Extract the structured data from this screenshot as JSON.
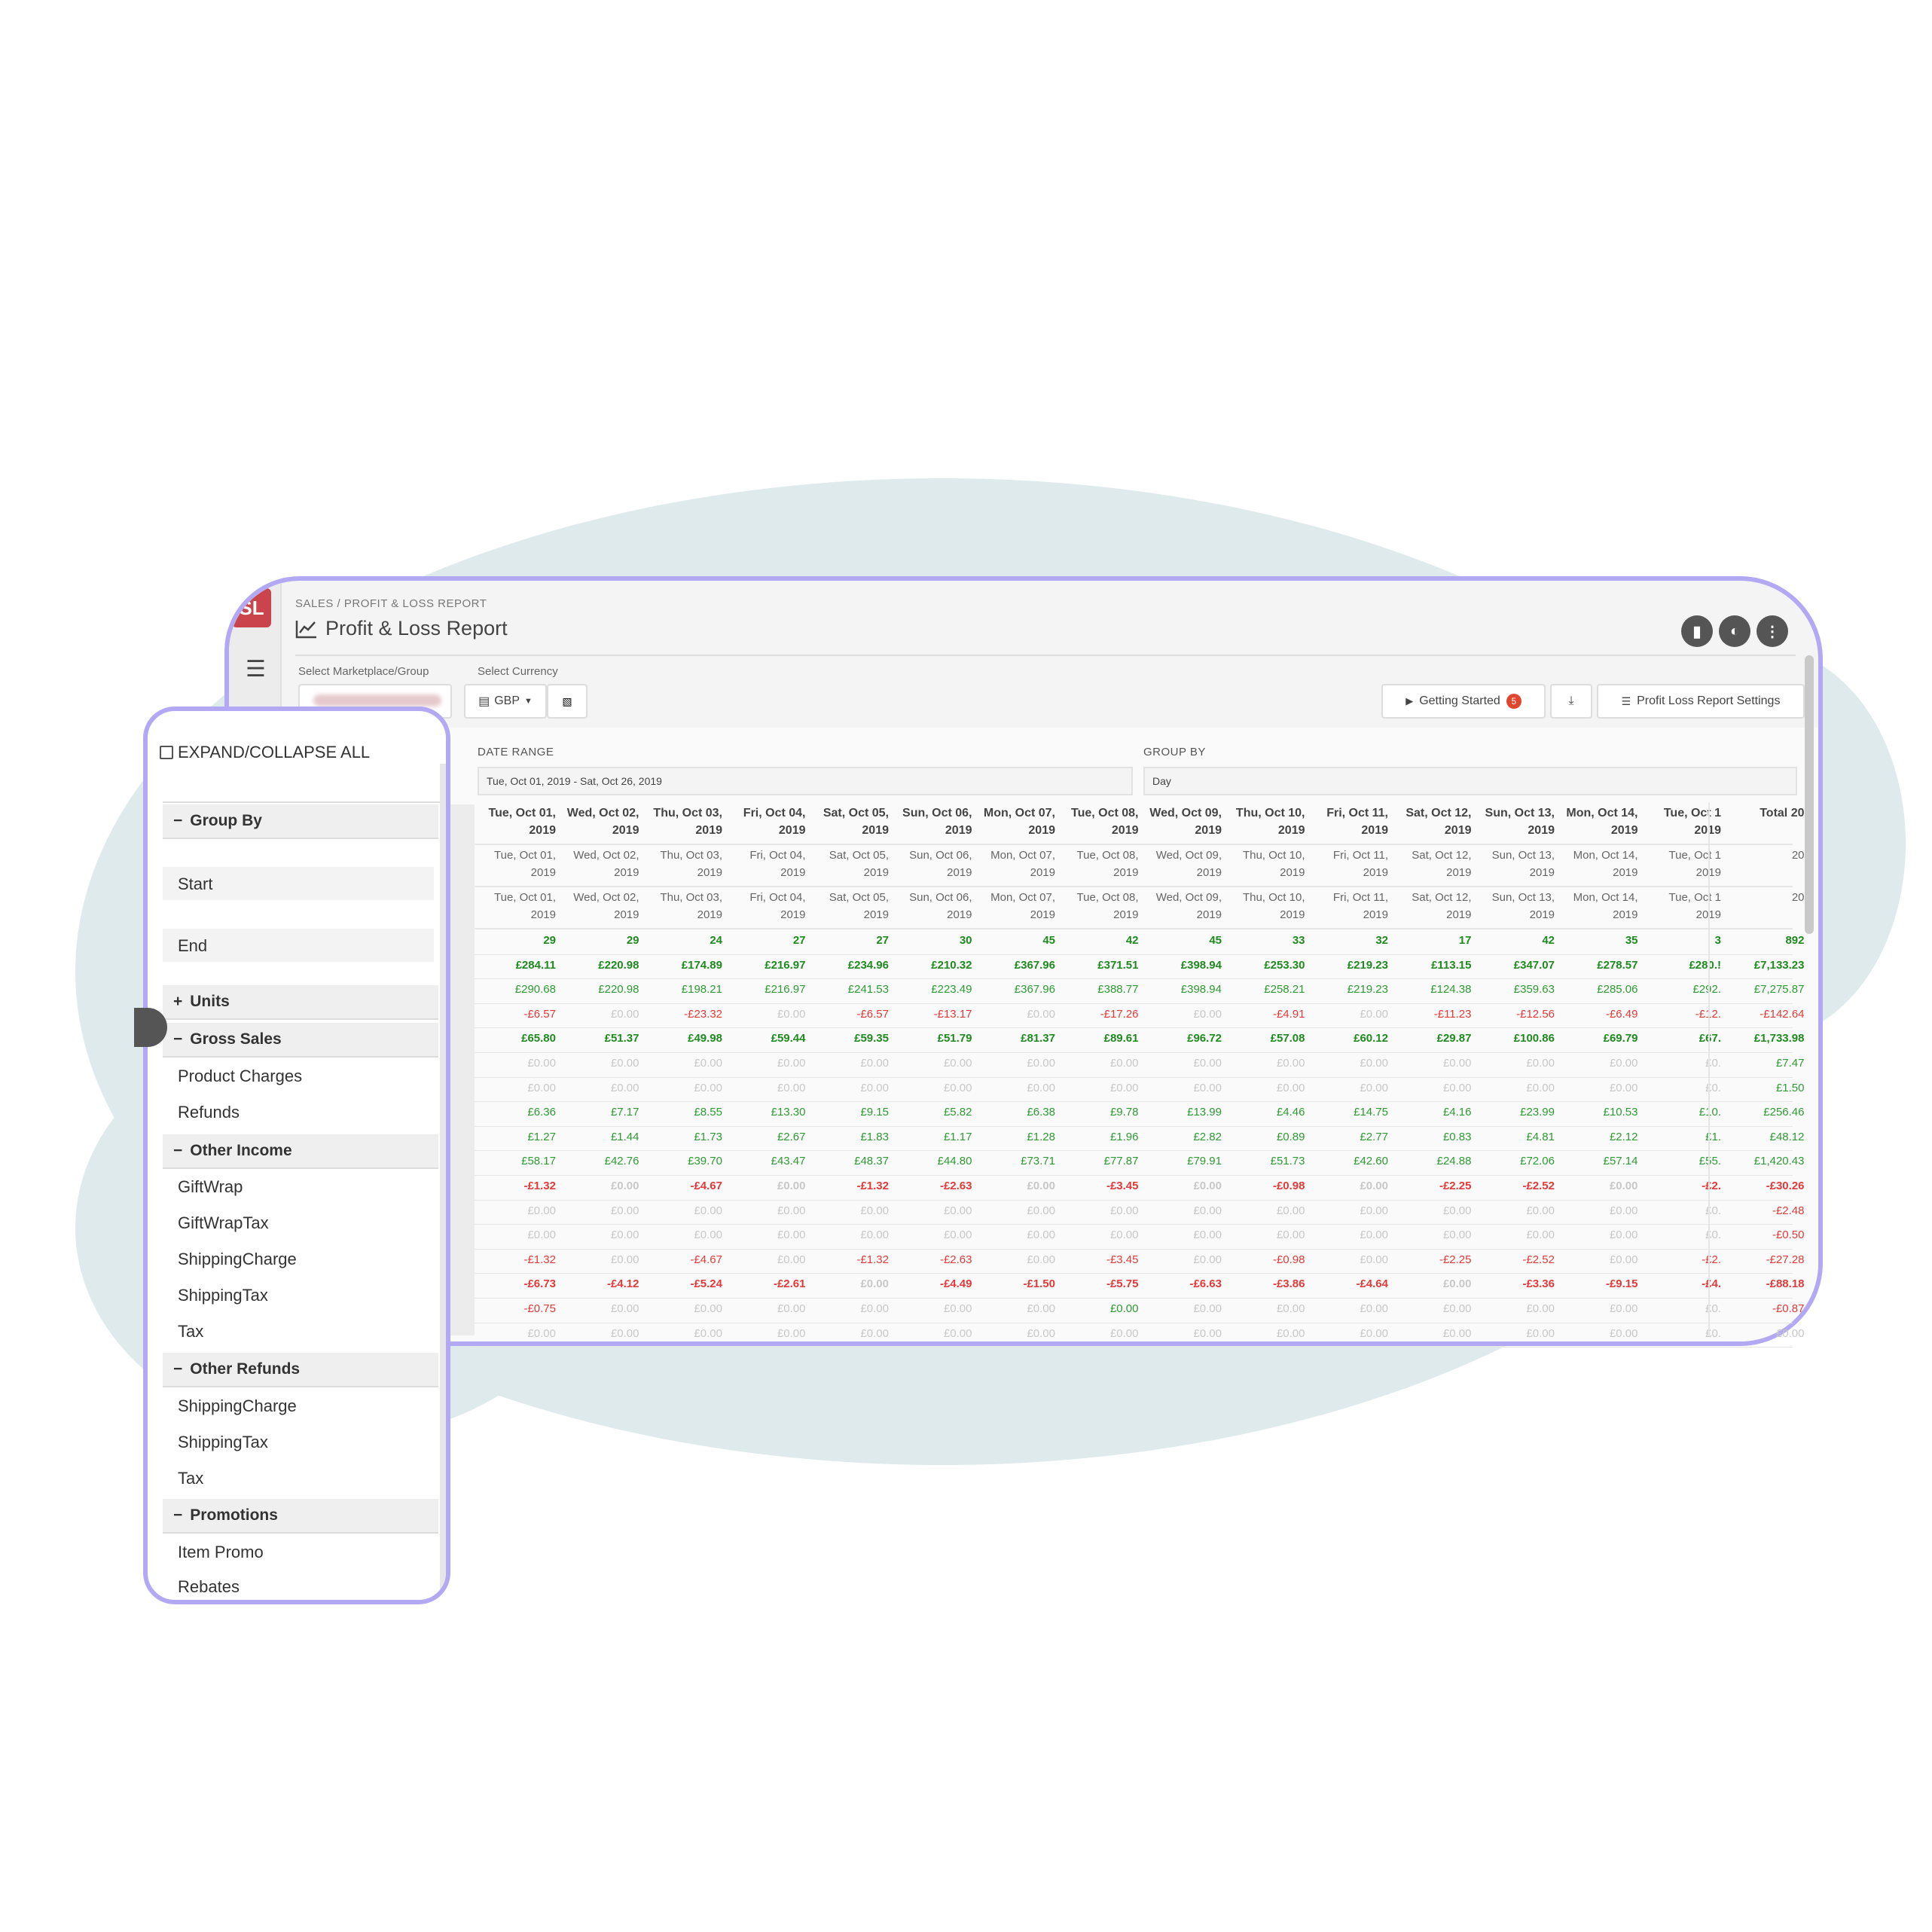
{
  "app": {
    "logo_text": "SL",
    "breadcrumb": "SALES / PROFIT & LOSS REPORT",
    "title": "Profit & Loss Report"
  },
  "filters": {
    "marketplace_label": "Select Marketplace/Group",
    "currency_label": "Select Currency",
    "currency_value": "GBP",
    "getting_started": "Getting Started",
    "getting_started_badge": "5",
    "settings_button": "Profit Loss Report Settings",
    "date_range_label": "DATE RANGE",
    "date_range_value": "Tue, Oct 01, 2019 - Sat, Oct 26, 2019",
    "group_by_label": "GROUP BY",
    "group_by_value": "Day"
  },
  "table": {
    "headers": [
      "Tue, Oct 01, 2019",
      "Wed, Oct 02, 2019",
      "Thu, Oct 03, 2019",
      "Fri, Oct 04, 2019",
      "Sat, Oct 05, 2019",
      "Sun, Oct 06, 2019",
      "Mon, Oct 07, 2019",
      "Tue, Oct 08, 2019",
      "Wed, Oct 09, 2019",
      "Thu, Oct 10, 2019",
      "Fri, Oct 11, 2019",
      "Sat, Oct 12, 2019",
      "Sun, Oct 13, 2019",
      "Mon, Oct 14, 2019",
      "Tue, Oct 1 2019",
      "Total 20"
    ],
    "start_dates": [
      "Tue, Oct 01, 2019",
      "Wed, Oct 02, 2019",
      "Thu, Oct 03, 2019",
      "Fri, Oct 04, 2019",
      "Sat, Oct 05, 2019",
      "Sun, Oct 06, 2019",
      "Mon, Oct 07, 2019",
      "Tue, Oct 08, 2019",
      "Wed, Oct 09, 2019",
      "Thu, Oct 10, 2019",
      "Fri, Oct 11, 2019",
      "Sat, Oct 12, 2019",
      "Sun, Oct 13, 2019",
      "Mon, Oct 14, 2019",
      "Tue, Oct 1 2019",
      "20"
    ],
    "end_dates": [
      "Tue, Oct 01, 2019",
      "Wed, Oct 02, 2019",
      "Thu, Oct 03, 2019",
      "Fri, Oct 04, 2019",
      "Sat, Oct 05, 2019",
      "Sun, Oct 06, 2019",
      "Mon, Oct 07, 2019",
      "Tue, Oct 08, 2019",
      "Wed, Oct 09, 2019",
      "Thu, Oct 10, 2019",
      "Fri, Oct 11, 2019",
      "Sat, Oct 12, 2019",
      "Sun, Oct 13, 2019",
      "Mon, Oct 14, 2019",
      "Tue, Oct 1 2019",
      "20"
    ],
    "rows": [
      {
        "style": "bold",
        "cells": [
          "29",
          "29",
          "24",
          "27",
          "27",
          "30",
          "45",
          "42",
          "45",
          "33",
          "32",
          "17",
          "42",
          "35",
          "3",
          "892"
        ],
        "colors": [
          "gb"
        ]
      },
      {
        "style": "bold",
        "cells": [
          "£284.11",
          "£220.98",
          "£174.89",
          "£216.97",
          "£234.96",
          "£210.32",
          "£367.96",
          "£371.51",
          "£398.94",
          "£253.30",
          "£219.23",
          "£113.15",
          "£347.07",
          "£278.57",
          "£280.!",
          "£7,133.23"
        ],
        "colors": [
          "gb"
        ]
      },
      {
        "style": "normal",
        "cells": [
          "£290.68",
          "£220.98",
          "£198.21",
          "£216.97",
          "£241.53",
          "£223.49",
          "£367.96",
          "£388.77",
          "£398.94",
          "£258.21",
          "£219.23",
          "£124.38",
          "£359.63",
          "£285.06",
          "£292.",
          "£7,275.87"
        ],
        "colors": [
          "g"
        ]
      },
      {
        "style": "normal",
        "cells": [
          "-£6.57",
          "£0.00",
          "-£23.32",
          "£0.00",
          "-£6.57",
          "-£13.17",
          "£0.00",
          "-£17.26",
          "£0.00",
          "-£4.91",
          "£0.00",
          "-£11.23",
          "-£12.56",
          "-£6.49",
          "-£12.",
          "-£142.64"
        ],
        "colors": [
          "r",
          "gr",
          "r",
          "gr",
          "r",
          "r",
          "gr",
          "r",
          "gr",
          "r",
          "gr",
          "r",
          "r",
          "r",
          "r",
          "r"
        ]
      },
      {
        "style": "bold",
        "cells": [
          "£65.80",
          "£51.37",
          "£49.98",
          "£59.44",
          "£59.35",
          "£51.79",
          "£81.37",
          "£89.61",
          "£96.72",
          "£57.08",
          "£60.12",
          "£29.87",
          "£100.86",
          "£69.79",
          "£67.",
          "£1,733.98"
        ],
        "colors": [
          "gb"
        ]
      },
      {
        "style": "normal",
        "cells": [
          "£0.00",
          "£0.00",
          "£0.00",
          "£0.00",
          "£0.00",
          "£0.00",
          "£0.00",
          "£0.00",
          "£0.00",
          "£0.00",
          "£0.00",
          "£0.00",
          "£0.00",
          "£0.00",
          "£0.",
          "£7.47"
        ],
        "colors": [
          "gr",
          "gr",
          "gr",
          "gr",
          "gr",
          "gr",
          "gr",
          "gr",
          "gr",
          "gr",
          "gr",
          "gr",
          "gr",
          "gr",
          "gr",
          "g"
        ]
      },
      {
        "style": "normal",
        "cells": [
          "£0.00",
          "£0.00",
          "£0.00",
          "£0.00",
          "£0.00",
          "£0.00",
          "£0.00",
          "£0.00",
          "£0.00",
          "£0.00",
          "£0.00",
          "£0.00",
          "£0.00",
          "£0.00",
          "£0.",
          "£1.50"
        ],
        "colors": [
          "gr",
          "gr",
          "gr",
          "gr",
          "gr",
          "gr",
          "gr",
          "gr",
          "gr",
          "gr",
          "gr",
          "gr",
          "gr",
          "gr",
          "gr",
          "g"
        ]
      },
      {
        "style": "normal",
        "cells": [
          "£6.36",
          "£7.17",
          "£8.55",
          "£13.30",
          "£9.15",
          "£5.82",
          "£6.38",
          "£9.78",
          "£13.99",
          "£4.46",
          "£14.75",
          "£4.16",
          "£23.99",
          "£10.53",
          "£10.",
          "£256.46"
        ],
        "colors": [
          "g"
        ]
      },
      {
        "style": "normal",
        "cells": [
          "£1.27",
          "£1.44",
          "£1.73",
          "£2.67",
          "£1.83",
          "£1.17",
          "£1.28",
          "£1.96",
          "£2.82",
          "£0.89",
          "£2.77",
          "£0.83",
          "£4.81",
          "£2.12",
          "£1.",
          "£48.12"
        ],
        "colors": [
          "g"
        ]
      },
      {
        "style": "normal",
        "cells": [
          "£58.17",
          "£42.76",
          "£39.70",
          "£43.47",
          "£48.37",
          "£44.80",
          "£73.71",
          "£77.87",
          "£79.91",
          "£51.73",
          "£42.60",
          "£24.88",
          "£72.06",
          "£57.14",
          "£55.",
          "£1,420.43"
        ],
        "colors": [
          "g"
        ]
      },
      {
        "style": "bold",
        "cells": [
          "-£1.32",
          "£0.00",
          "-£4.67",
          "£0.00",
          "-£1.32",
          "-£2.63",
          "£0.00",
          "-£3.45",
          "£0.00",
          "-£0.98",
          "£0.00",
          "-£2.25",
          "-£2.52",
          "£0.00",
          "-£2.",
          "-£30.26"
        ],
        "colors": [
          "r",
          "gr",
          "r",
          "gr",
          "r",
          "r",
          "gr",
          "r",
          "gr",
          "r",
          "gr",
          "r",
          "r",
          "gr",
          "r",
          "r"
        ]
      },
      {
        "style": "normal",
        "cells": [
          "£0.00",
          "£0.00",
          "£0.00",
          "£0.00",
          "£0.00",
          "£0.00",
          "£0.00",
          "£0.00",
          "£0.00",
          "£0.00",
          "£0.00",
          "£0.00",
          "£0.00",
          "£0.00",
          "£0.",
          "-£2.48"
        ],
        "colors": [
          "gr",
          "gr",
          "gr",
          "gr",
          "gr",
          "gr",
          "gr",
          "gr",
          "gr",
          "gr",
          "gr",
          "gr",
          "gr",
          "gr",
          "gr",
          "r"
        ]
      },
      {
        "style": "normal",
        "cells": [
          "£0.00",
          "£0.00",
          "£0.00",
          "£0.00",
          "£0.00",
          "£0.00",
          "£0.00",
          "£0.00",
          "£0.00",
          "£0.00",
          "£0.00",
          "£0.00",
          "£0.00",
          "£0.00",
          "£0.",
          "-£0.50"
        ],
        "colors": [
          "gr",
          "gr",
          "gr",
          "gr",
          "gr",
          "gr",
          "gr",
          "gr",
          "gr",
          "gr",
          "gr",
          "gr",
          "gr",
          "gr",
          "gr",
          "r"
        ]
      },
      {
        "style": "normal",
        "cells": [
          "-£1.32",
          "£0.00",
          "-£4.67",
          "£0.00",
          "-£1.32",
          "-£2.63",
          "£0.00",
          "-£3.45",
          "£0.00",
          "-£0.98",
          "£0.00",
          "-£2.25",
          "-£2.52",
          "£0.00",
          "-£2.",
          "-£27.28"
        ],
        "colors": [
          "r",
          "gr",
          "r",
          "gr",
          "r",
          "r",
          "gr",
          "r",
          "gr",
          "r",
          "gr",
          "r",
          "r",
          "gr",
          "r",
          "r"
        ]
      },
      {
        "style": "bold",
        "cells": [
          "-£6.73",
          "-£4.12",
          "-£5.24",
          "-£2.61",
          "£0.00",
          "-£4.49",
          "-£1.50",
          "-£5.75",
          "-£6.63",
          "-£3.86",
          "-£4.64",
          "£0.00",
          "-£3.36",
          "-£9.15",
          "-£4.",
          "-£88.18"
        ],
        "colors": [
          "r",
          "r",
          "r",
          "r",
          "gr",
          "r",
          "r",
          "r",
          "r",
          "r",
          "r",
          "gr",
          "r",
          "r",
          "r",
          "r"
        ]
      },
      {
        "style": "normal",
        "cells": [
          "-£0.75",
          "£0.00",
          "£0.00",
          "£0.00",
          "£0.00",
          "£0.00",
          "£0.00",
          "£0.00",
          "£0.00",
          "£0.00",
          "£0.00",
          "£0.00",
          "£0.00",
          "£0.00",
          "£0.",
          "-£0.87"
        ],
        "colors": [
          "r",
          "gr",
          "gr",
          "gr",
          "gr",
          "gr",
          "gr",
          "g",
          "gr",
          "gr",
          "gr",
          "gr",
          "gr",
          "gr",
          "gr",
          "r"
        ]
      },
      {
        "style": "normal",
        "cells": [
          "£0.00",
          "£0.00",
          "£0.00",
          "£0.00",
          "£0.00",
          "£0.00",
          "£0.00",
          "£0.00",
          "£0.00",
          "£0.00",
          "£0.00",
          "£0.00",
          "£0.00",
          "£0.00",
          "£0.",
          "£0.00"
        ],
        "colors": [
          "gr"
        ]
      }
    ]
  },
  "sidebar": {
    "expand_label": "EXPAND/COLLAPSE ALL",
    "group_by": "Group By",
    "start": "Start",
    "end": "End",
    "units": "Units",
    "gross_sales": "Gross Sales",
    "product_charges": "Product Charges",
    "refunds": "Refunds",
    "other_income": "Other Income",
    "gift_wrap": "GiftWrap",
    "gift_wrap_tax": "GiftWrapTax",
    "shipping_charge": "ShippingCharge",
    "shipping_tax": "ShippingTax",
    "tax": "Tax",
    "other_refunds": "Other Refunds",
    "or_shipping_charge": "ShippingCharge",
    "or_shipping_tax": "ShippingTax",
    "or_tax": "Tax",
    "promotions": "Promotions",
    "item_promo": "Item Promo",
    "rebates": "Rebates"
  },
  "colors": {
    "frame": "#b2a8f4",
    "positive": "#2e9a33",
    "negative": "#e23a3a",
    "zero": "#c8c8c8",
    "brand": "#c9454b"
  }
}
